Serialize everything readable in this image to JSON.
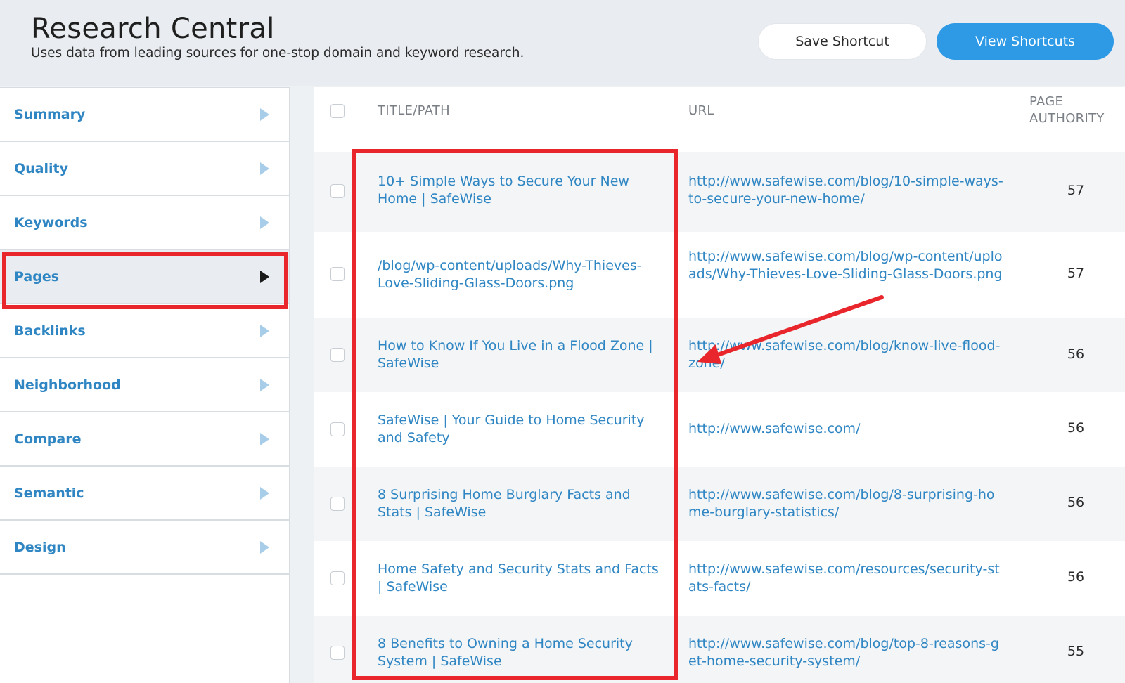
{
  "header": {
    "title": "Research Central",
    "subtitle": "Uses data from leading sources for one-stop domain and keyword research.",
    "save_label": "Save Shortcut",
    "view_label": "View Shortcuts"
  },
  "sidebar": {
    "items": [
      {
        "label": "Summary"
      },
      {
        "label": "Quality"
      },
      {
        "label": "Keywords"
      },
      {
        "label": "Pages",
        "active": true
      },
      {
        "label": "Backlinks"
      },
      {
        "label": "Neighborhood"
      },
      {
        "label": "Compare"
      },
      {
        "label": "Semantic"
      },
      {
        "label": "Design"
      }
    ]
  },
  "table": {
    "columns": {
      "title": "TITLE/PATH",
      "url": "URL",
      "pa_line1": "PAGE",
      "pa_line2": "AUTHORITY"
    },
    "rows": [
      {
        "title": "10+ Simple Ways to Secure Your New Home | SafeWise",
        "url": "http://www.safewise.com/blog/10-simple-ways-to-secure-your-new-home/",
        "pa": "57"
      },
      {
        "title": "/blog/wp-content/uploads/Why-Thieves-Love-Sliding-Glass-Doors.png",
        "url": "http://www.safewise.com/blog/wp-content/uploads/Why-Thieves-Love-Sliding-Glass-Doors.png",
        "pa": "57"
      },
      {
        "title": "How to Know If You Live in a Flood Zone | SafeWise",
        "url": "http://www.safewise.com/blog/know-live-flood-zone/",
        "pa": "56"
      },
      {
        "title": "SafeWise | Your Guide to Home Security and Safety",
        "url": "http://www.safewise.com/",
        "pa": "56"
      },
      {
        "title": "8 Surprising Home Burglary Facts and Stats | SafeWise",
        "url": "http://www.safewise.com/blog/8-surprising-home-burglary-statistics/",
        "pa": "56"
      },
      {
        "title": "Home Safety and Security Stats and Facts | SafeWise",
        "url": "http://www.safewise.com/resources/security-stats-facts/",
        "pa": "56"
      },
      {
        "title": "8 Benefits to Owning a Home Security System | SafeWise",
        "url": "http://www.safewise.com/blog/top-8-reasons-get-home-security-system/",
        "pa": "55"
      }
    ]
  },
  "colors": {
    "link": "#2f86c3",
    "primary_button": "#2e9ae6",
    "annotation": "#e8262b"
  }
}
